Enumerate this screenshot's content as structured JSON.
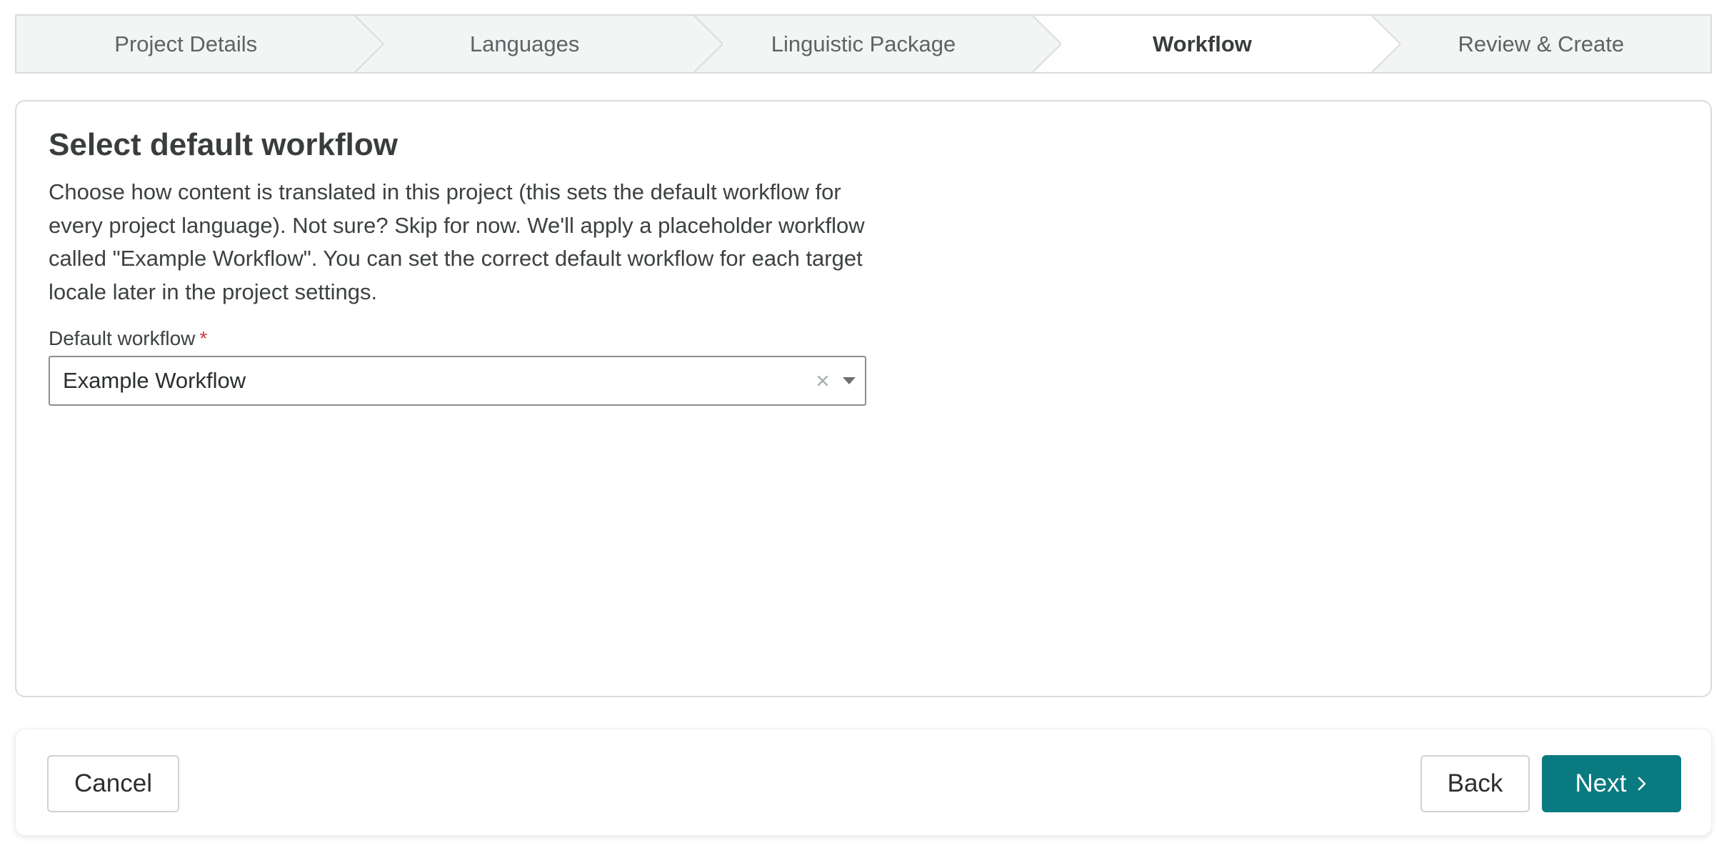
{
  "stepper": {
    "steps": [
      {
        "label": "Project Details",
        "active": false
      },
      {
        "label": "Languages",
        "active": false
      },
      {
        "label": "Linguistic Package",
        "active": false
      },
      {
        "label": "Workflow",
        "active": true
      },
      {
        "label": "Review & Create",
        "active": false
      }
    ]
  },
  "main": {
    "title": "Select default workflow",
    "description": "Choose how content is translated in this project (this sets the default workflow for every project language). Not sure? Skip for now. We'll apply a placeholder workflow called \"Example Workflow\". You can set the correct default workflow for each target locale later in the project settings.",
    "field": {
      "label": "Default workflow",
      "required_mark": "*",
      "value": "Example Workflow",
      "clear_icon": "close-icon",
      "caret_icon": "caret-down-icon"
    }
  },
  "footer": {
    "cancel_label": "Cancel",
    "back_label": "Back",
    "next_label": "Next",
    "next_icon": "chevron-right-icon"
  },
  "colors": {
    "primary": "#097a80",
    "required": "#d33a3a",
    "stepper_bg": "#f3f4f4",
    "border": "#d8dcdc"
  }
}
